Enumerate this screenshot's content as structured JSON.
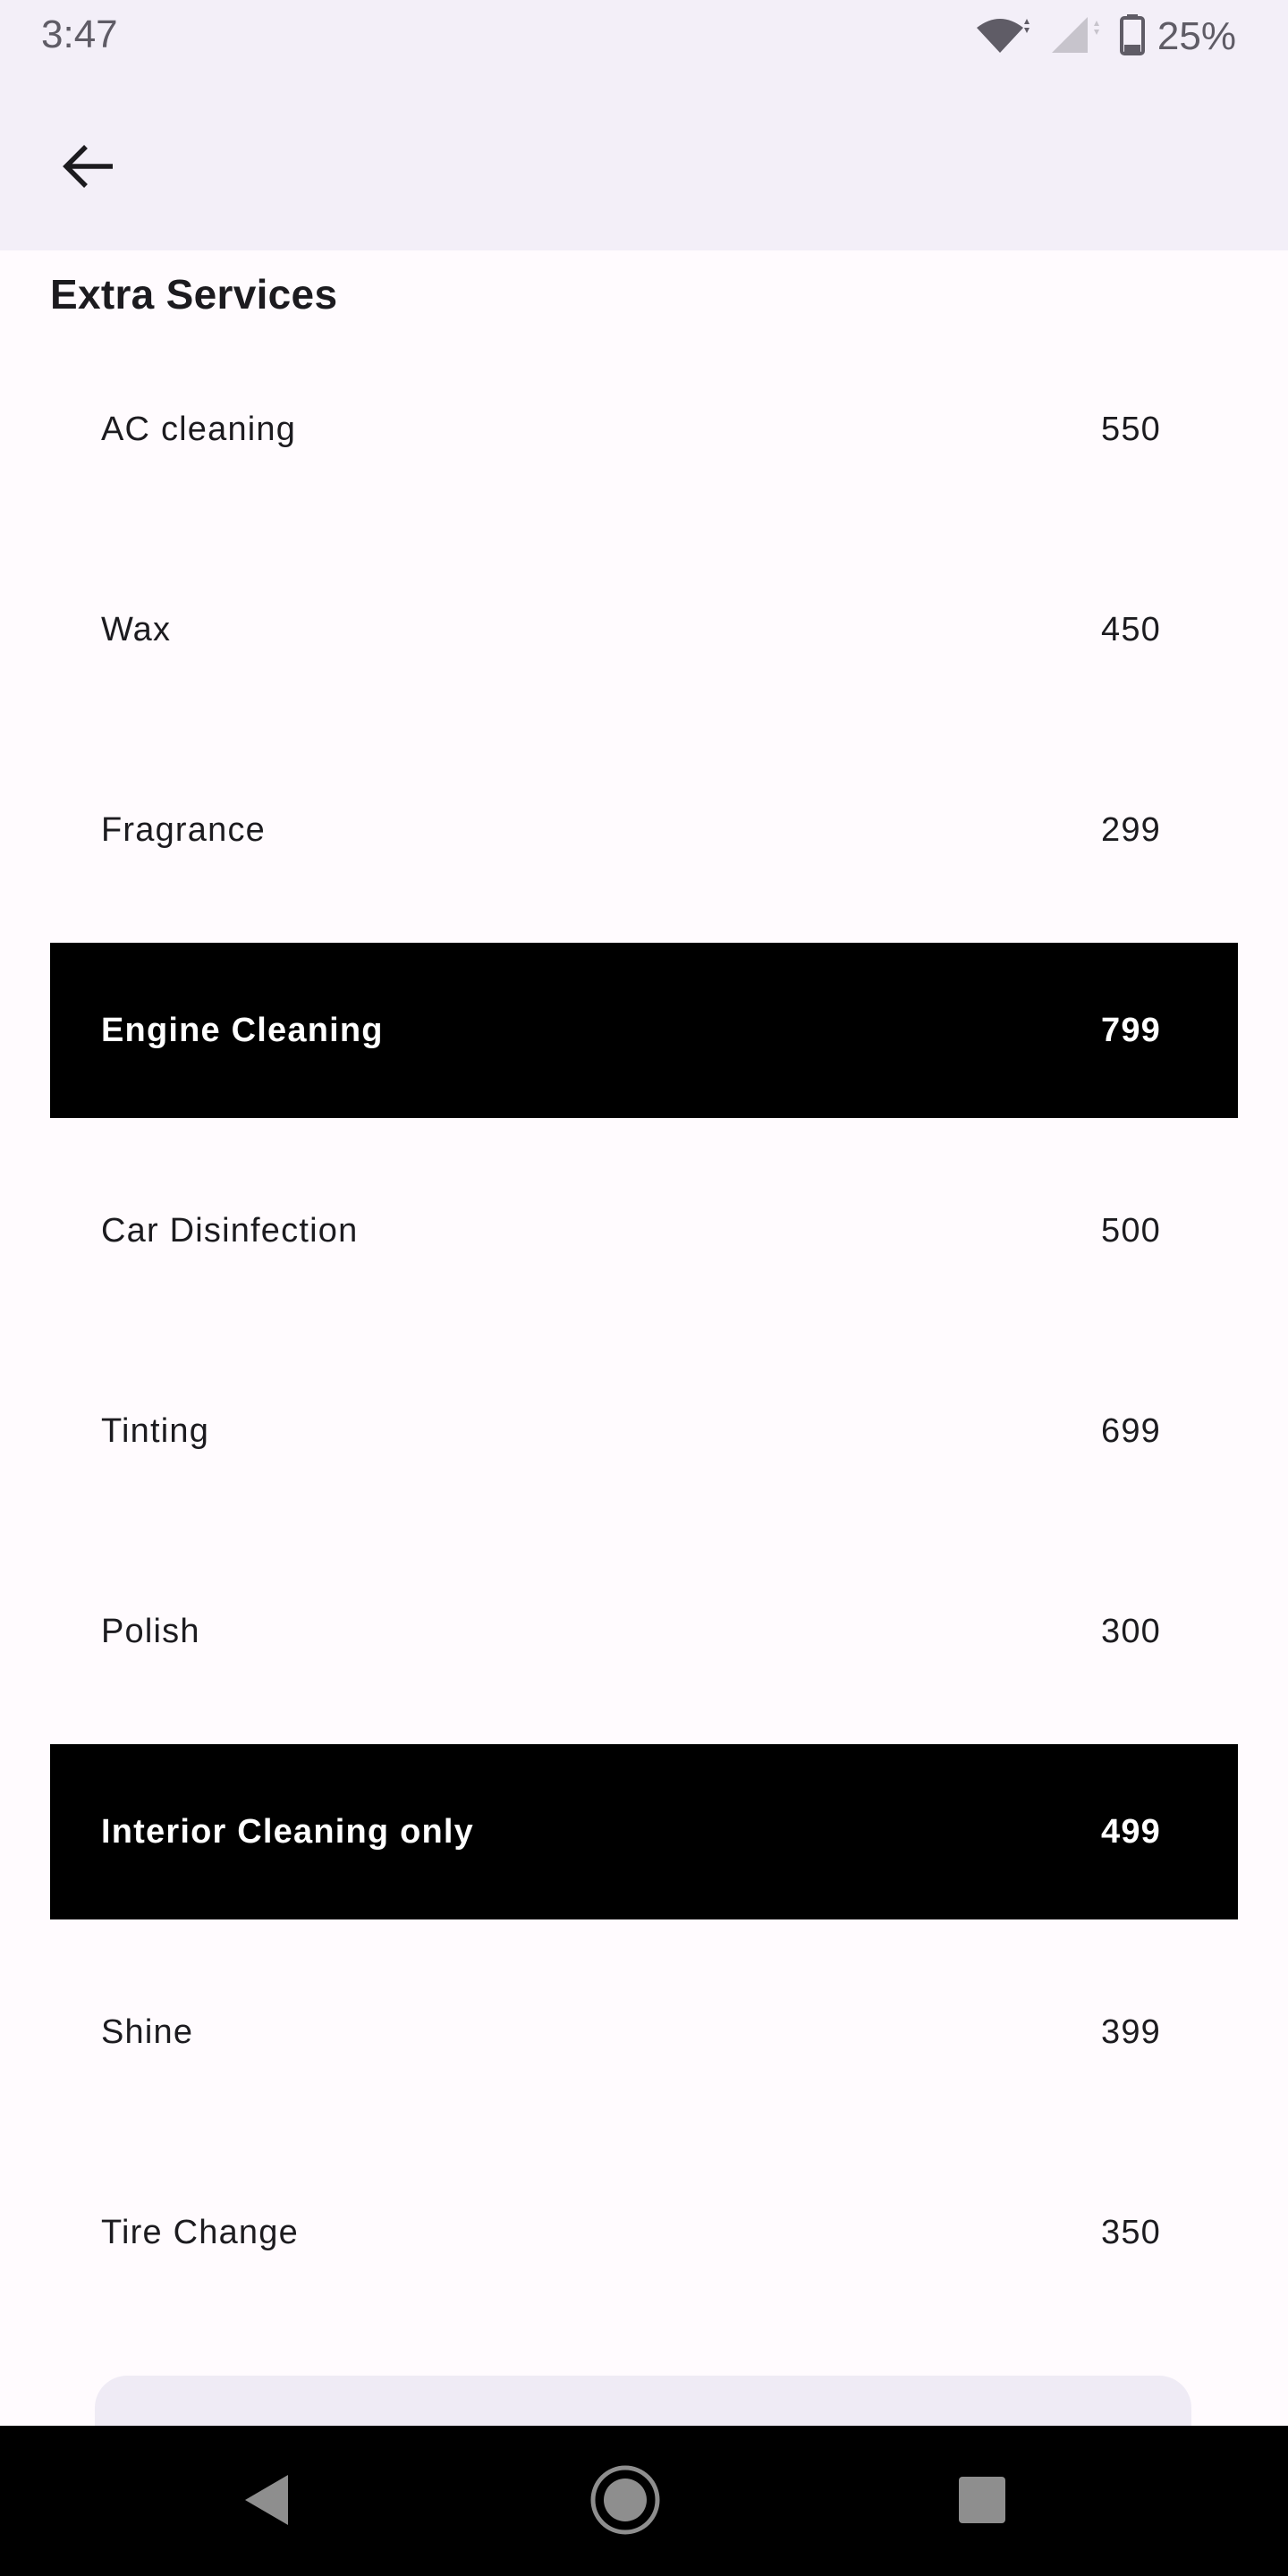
{
  "status_bar": {
    "time": "3:47",
    "battery": "25%",
    "icons": [
      "wifi-icon",
      "cellular-signal-icon",
      "battery-icon"
    ]
  },
  "app_bar": {
    "back_icon": "arrow-back-icon"
  },
  "page": {
    "title": "Extra Services"
  },
  "services": [
    {
      "name": "AC cleaning",
      "price": "550",
      "selected": false
    },
    {
      "name": "Wax",
      "price": "450",
      "selected": false
    },
    {
      "name": "Fragrance",
      "price": "299",
      "selected": false
    },
    {
      "name": "Engine Cleaning",
      "price": "799",
      "selected": true
    },
    {
      "name": "Car Disinfection",
      "price": "500",
      "selected": false
    },
    {
      "name": "Tinting",
      "price": "699",
      "selected": false
    },
    {
      "name": "Polish",
      "price": "300",
      "selected": false
    },
    {
      "name": "Interior Cleaning only",
      "price": "499",
      "selected": true
    },
    {
      "name": "Shine",
      "price": "399",
      "selected": false
    },
    {
      "name": "Tire Change",
      "price": "350",
      "selected": false
    }
  ],
  "nav_bar": {
    "buttons": [
      "nav-back-icon",
      "nav-home-icon",
      "nav-recents-icon"
    ]
  },
  "colors": {
    "surface": "#fffbfe",
    "app_bar": "#f3eff8",
    "selected_bg": "#000000",
    "selected_text": "#ffffff",
    "text": "#1c1b1f"
  }
}
